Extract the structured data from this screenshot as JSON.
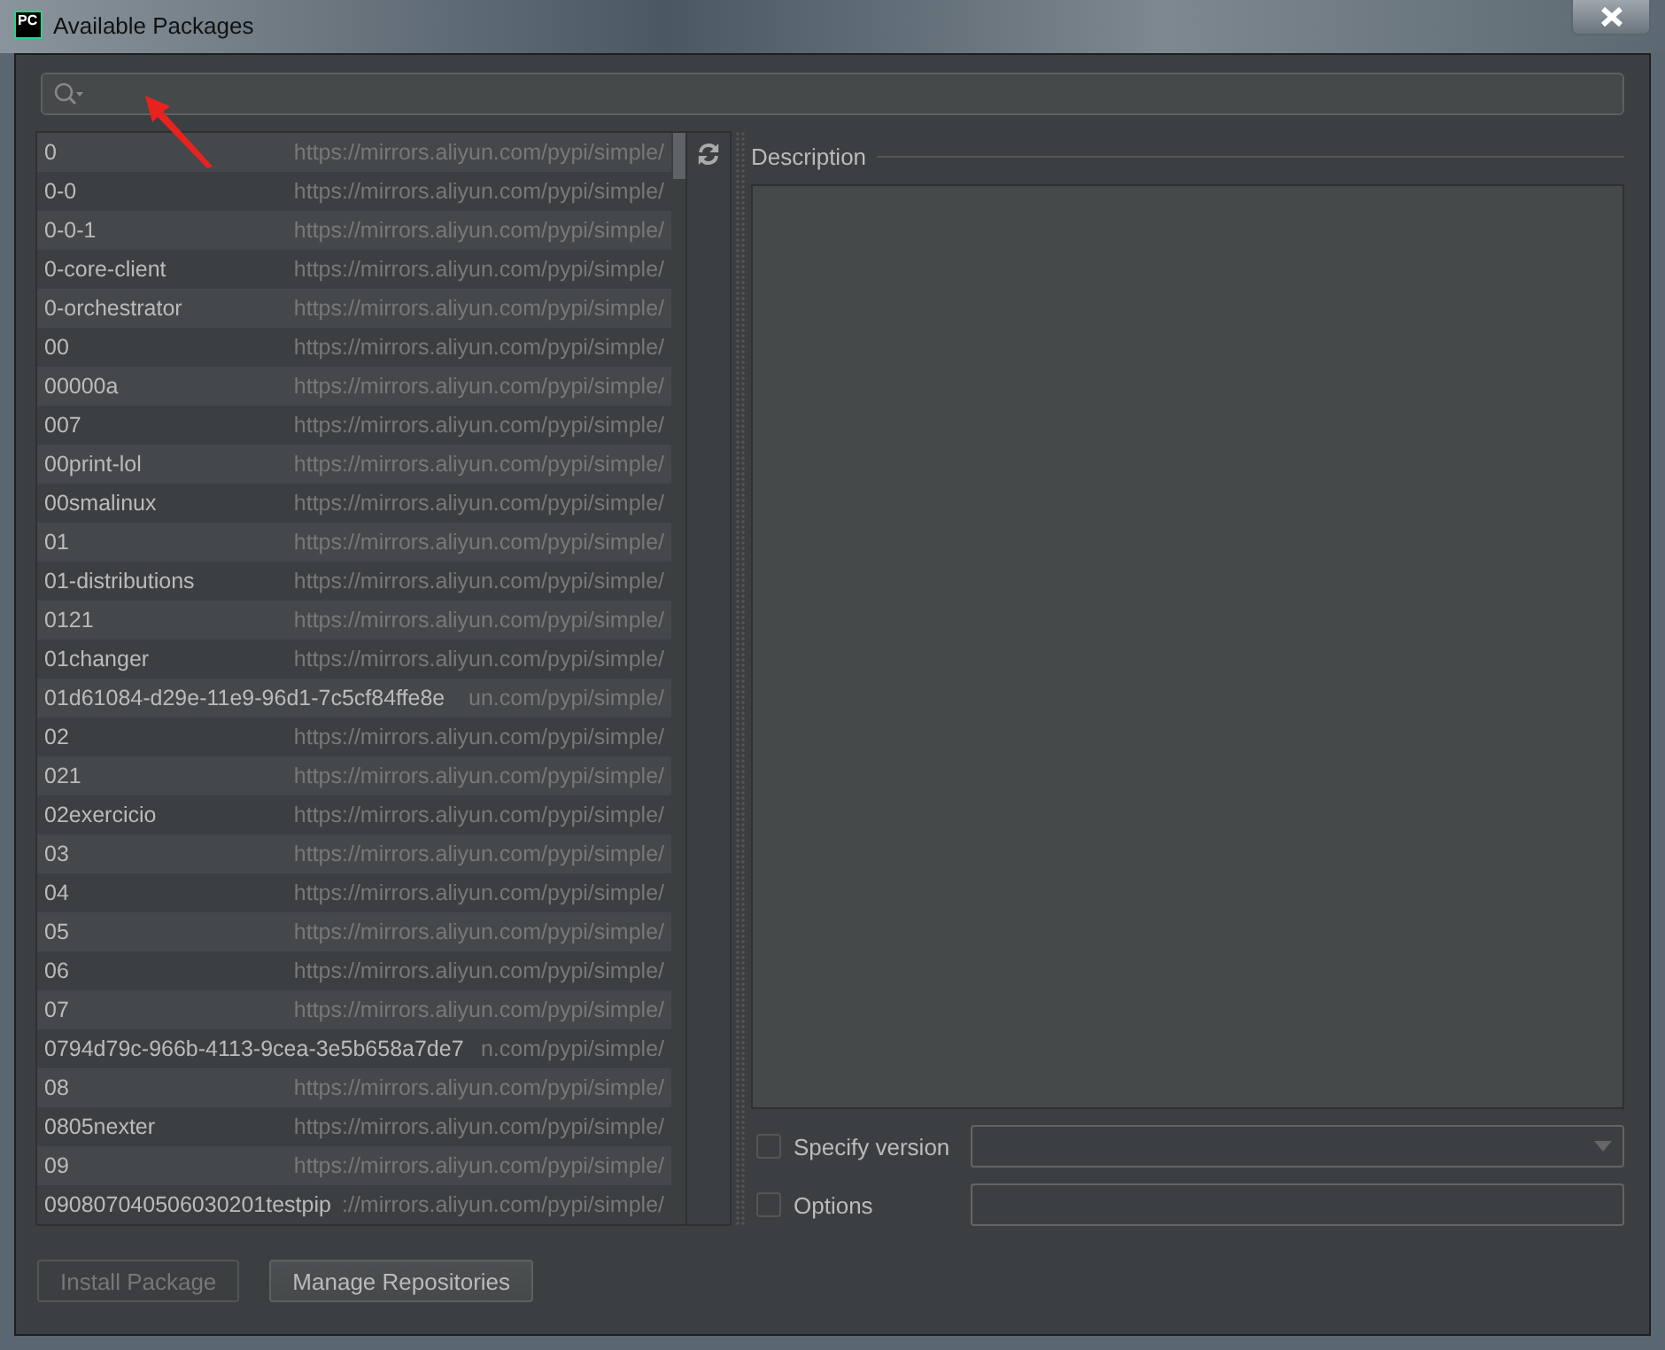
{
  "window": {
    "title": "Available Packages",
    "logo": "PC"
  },
  "packages": [
    {
      "name": "0",
      "repository": "https://mirrors.aliyun.com/pypi/simple/"
    },
    {
      "name": "0-0",
      "repository": "https://mirrors.aliyun.com/pypi/simple/"
    },
    {
      "name": "0-0-1",
      "repository": "https://mirrors.aliyun.com/pypi/simple/"
    },
    {
      "name": "0-core-client",
      "repository": "https://mirrors.aliyun.com/pypi/simple/"
    },
    {
      "name": "0-orchestrator",
      "repository": "https://mirrors.aliyun.com/pypi/simple/"
    },
    {
      "name": "00",
      "repository": "https://mirrors.aliyun.com/pypi/simple/"
    },
    {
      "name": "00000a",
      "repository": "https://mirrors.aliyun.com/pypi/simple/"
    },
    {
      "name": "007",
      "repository": "https://mirrors.aliyun.com/pypi/simple/"
    },
    {
      "name": "00print-lol",
      "repository": "https://mirrors.aliyun.com/pypi/simple/"
    },
    {
      "name": "00smalinux",
      "repository": "https://mirrors.aliyun.com/pypi/simple/"
    },
    {
      "name": "01",
      "repository": "https://mirrors.aliyun.com/pypi/simple/"
    },
    {
      "name": "01-distributions",
      "repository": "https://mirrors.aliyun.com/pypi/simple/"
    },
    {
      "name": "0121",
      "repository": "https://mirrors.aliyun.com/pypi/simple/"
    },
    {
      "name": "01changer",
      "repository": "https://mirrors.aliyun.com/pypi/simple/"
    },
    {
      "name": "01d61084-d29e-11e9-96d1-7c5cf84ffe8e",
      "repository": "un.com/pypi/simple/"
    },
    {
      "name": "02",
      "repository": "https://mirrors.aliyun.com/pypi/simple/"
    },
    {
      "name": "021",
      "repository": "https://mirrors.aliyun.com/pypi/simple/"
    },
    {
      "name": "02exercicio",
      "repository": "https://mirrors.aliyun.com/pypi/simple/"
    },
    {
      "name": "03",
      "repository": "https://mirrors.aliyun.com/pypi/simple/"
    },
    {
      "name": "04",
      "repository": "https://mirrors.aliyun.com/pypi/simple/"
    },
    {
      "name": "05",
      "repository": "https://mirrors.aliyun.com/pypi/simple/"
    },
    {
      "name": "06",
      "repository": "https://mirrors.aliyun.com/pypi/simple/"
    },
    {
      "name": "07",
      "repository": "https://mirrors.aliyun.com/pypi/simple/"
    },
    {
      "name": "0794d79c-966b-4113-9cea-3e5b658a7de7",
      "repository": "n.com/pypi/simple/"
    },
    {
      "name": "08",
      "repository": "https://mirrors.aliyun.com/pypi/simple/"
    },
    {
      "name": "0805nexter",
      "repository": "https://mirrors.aliyun.com/pypi/simple/"
    },
    {
      "name": "09",
      "repository": "https://mirrors.aliyun.com/pypi/simple/"
    },
    {
      "name": "090807040506030201testpip",
      "repository": "://mirrors.aliyun.com/pypi/simple/"
    }
  ],
  "description": {
    "label": "Description"
  },
  "options": [
    {
      "kind": "dropdown",
      "label": "Specify version",
      "checked": false
    },
    {
      "kind": "text",
      "label": "Options",
      "checked": false
    }
  ],
  "buttons": [
    {
      "label": "Install Package",
      "disabled": true
    },
    {
      "label": "Manage Repositories",
      "disabled": false
    }
  ]
}
